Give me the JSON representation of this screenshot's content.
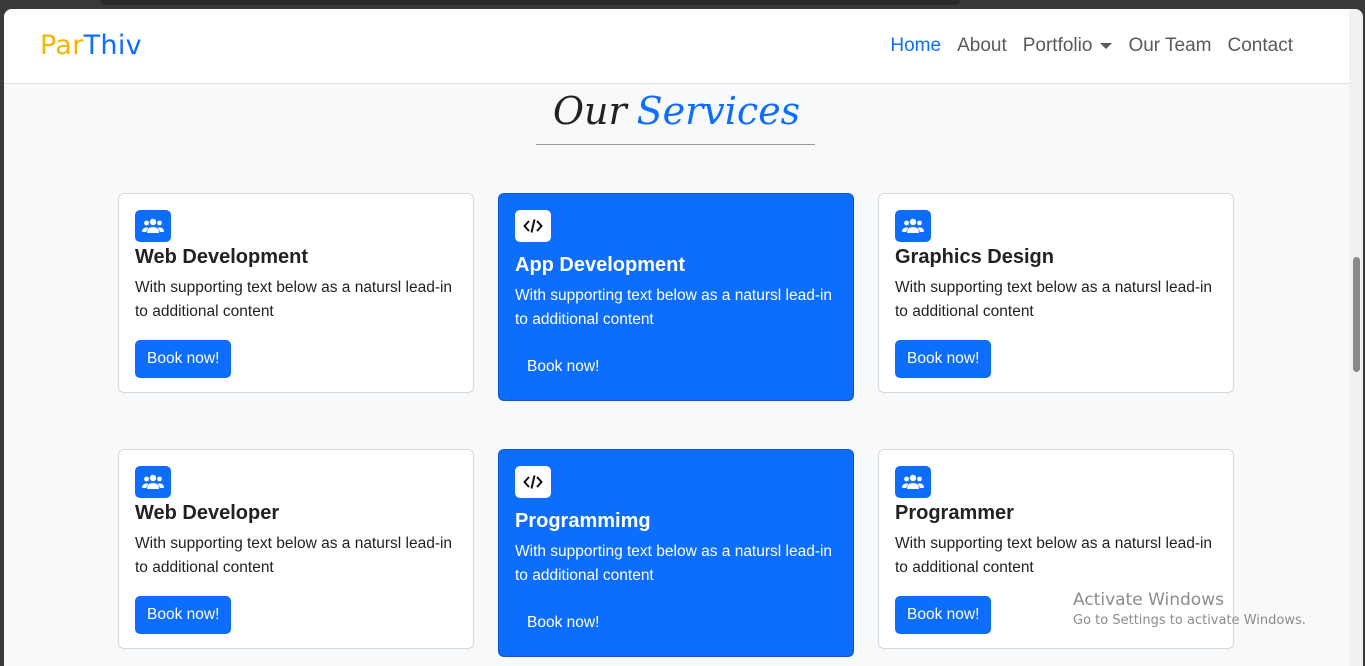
{
  "brand": {
    "part1": "Par",
    "part2": "Thiv"
  },
  "nav": {
    "home": "Home",
    "about": "About",
    "portfolio": "Portfolio",
    "team": "Our Team",
    "contact": "Contact"
  },
  "section": {
    "title_plain": "Our",
    "title_accent": "Services"
  },
  "cards": [
    {
      "title": "Web Development",
      "text": "With supporting text below as a natursl lead-in to additional content",
      "button": "Book now!",
      "icon": "users-icon"
    },
    {
      "title": "App Development",
      "text": "With supporting text below as a natursl lead-in to additional content",
      "button": "Book now!",
      "icon": "code-icon"
    },
    {
      "title": "Graphics Design",
      "text": "With supporting text below as a natursl lead-in to additional content",
      "button": "Book now!",
      "icon": "users-icon"
    },
    {
      "title": "Web Developer",
      "text": "With supporting text below as a natursl lead-in to additional content",
      "button": "Book now!",
      "icon": "users-icon"
    },
    {
      "title": "Programmimg",
      "text": "With supporting text below as a natursl lead-in to additional content",
      "button": "Book now!",
      "icon": "code-icon"
    },
    {
      "title": "Programmer",
      "text": "With supporting text below as a natursl lead-in to additional content",
      "button": "Book now!",
      "icon": "users-icon"
    }
  ],
  "watermark": {
    "line1": "Activate Windows",
    "line2": "Go to Settings to activate Windows."
  },
  "colors": {
    "primary": "#0d6efd",
    "brand_yellow": "#f5b400"
  }
}
